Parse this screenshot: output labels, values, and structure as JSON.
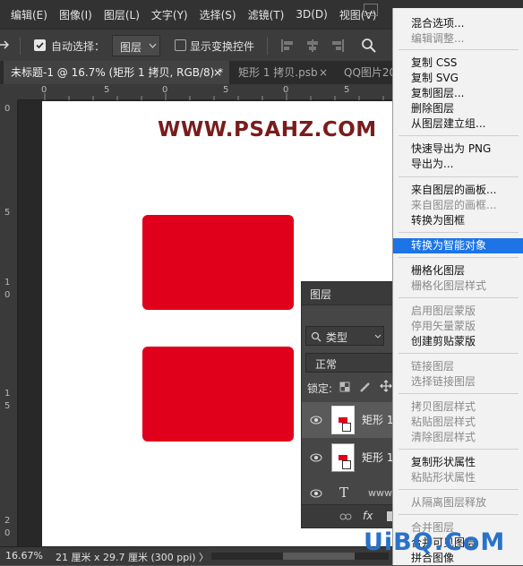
{
  "menubar": {
    "items": [
      "编辑(E)",
      "图像(I)",
      "图层(L)",
      "文字(Y)",
      "选择(S)",
      "滤镜(T)",
      "3D(D)",
      "视图(V)"
    ]
  },
  "options": {
    "auto_select_label": "自动选择：",
    "auto_select_value": "图层",
    "show_transform_label": "显示变换控件"
  },
  "tabs": [
    {
      "label": "未标题-1 @ 16.7% (矩形 1 拷贝, RGB/8) *",
      "close": "×"
    },
    {
      "label": "矩形 1 拷贝.psb",
      "close": "×"
    },
    {
      "label": "QQ图片20"
    }
  ],
  "ruler_top": [
    "0",
    "5",
    "0",
    "5",
    "0",
    "5"
  ],
  "ruler_left": [
    "0",
    "5",
    "1",
    "0",
    "1",
    "5",
    "2",
    "0"
  ],
  "canvas": {
    "watermark": "WWW.PSAHZ.COM"
  },
  "layers_panel": {
    "title": "图层",
    "filter_kind": "类型",
    "blend_mode": "正常",
    "lock_label": "锁定:",
    "layers": [
      {
        "name": "矩形 1"
      },
      {
        "name": "矩形 1"
      },
      {
        "name": "www"
      }
    ],
    "fx_label": "fx"
  },
  "statusbar": {
    "zoom": "16.67%",
    "doc_info": "21 厘米 x 29.7 厘米 (300 ppi)",
    "arrow": "〉"
  },
  "context_menu": {
    "items": [
      {
        "label": "混合选项...",
        "disabled": false,
        "highlighted": false
      },
      {
        "label": "编辑调整...",
        "disabled": true,
        "highlighted": false
      },
      {
        "label": "复制 CSS",
        "disabled": false,
        "highlighted": false
      },
      {
        "label": "复制 SVG",
        "disabled": false,
        "highlighted": false
      },
      {
        "label": "复制图层...",
        "disabled": false,
        "highlighted": false
      },
      {
        "label": "删除图层",
        "disabled": false,
        "highlighted": false
      },
      {
        "label": "从图层建立组...",
        "disabled": false,
        "highlighted": false
      },
      {
        "label": "快速导出为 PNG",
        "disabled": false,
        "highlighted": false
      },
      {
        "label": "导出为...",
        "disabled": false,
        "highlighted": false
      },
      {
        "label": "来自图层的画板...",
        "disabled": false,
        "highlighted": false
      },
      {
        "label": "来自图层的画框...",
        "disabled": true,
        "highlighted": false
      },
      {
        "label": "转换为图框",
        "disabled": false,
        "highlighted": false
      },
      {
        "label": "转换为智能对象",
        "disabled": false,
        "highlighted": true
      },
      {
        "label": "栅格化图层",
        "disabled": false,
        "highlighted": false
      },
      {
        "label": "栅格化图层样式",
        "disabled": true,
        "highlighted": false
      },
      {
        "label": "启用图层蒙版",
        "disabled": true,
        "highlighted": false
      },
      {
        "label": "停用矢量蒙版",
        "disabled": true,
        "highlighted": false
      },
      {
        "label": "创建剪贴蒙版",
        "disabled": false,
        "highlighted": false
      },
      {
        "label": "链接图层",
        "disabled": true,
        "highlighted": false
      },
      {
        "label": "选择链接图层",
        "disabled": true,
        "highlighted": false
      },
      {
        "label": "拷贝图层样式",
        "disabled": true,
        "highlighted": false
      },
      {
        "label": "粘贴图层样式",
        "disabled": true,
        "highlighted": false
      },
      {
        "label": "清除图层样式",
        "disabled": true,
        "highlighted": false
      },
      {
        "label": "复制形状属性",
        "disabled": false,
        "highlighted": false
      },
      {
        "label": "粘贴形状属性",
        "disabled": true,
        "highlighted": false
      },
      {
        "label": "从隔离图层释放",
        "disabled": true,
        "highlighted": false
      },
      {
        "label": "合并图层",
        "disabled": true,
        "highlighted": false
      },
      {
        "label": "合并可见图层",
        "disabled": false,
        "highlighted": false
      },
      {
        "label": "拼合图像",
        "disabled": false,
        "highlighted": false
      }
    ]
  },
  "overlay_watermark": "UiBQ.CoM",
  "colors": {
    "red_shape": "#e0001b",
    "highlight": "#1c74e6",
    "watermark_text": "#7a1c1c",
    "uibq_text": "#2a72c8"
  }
}
